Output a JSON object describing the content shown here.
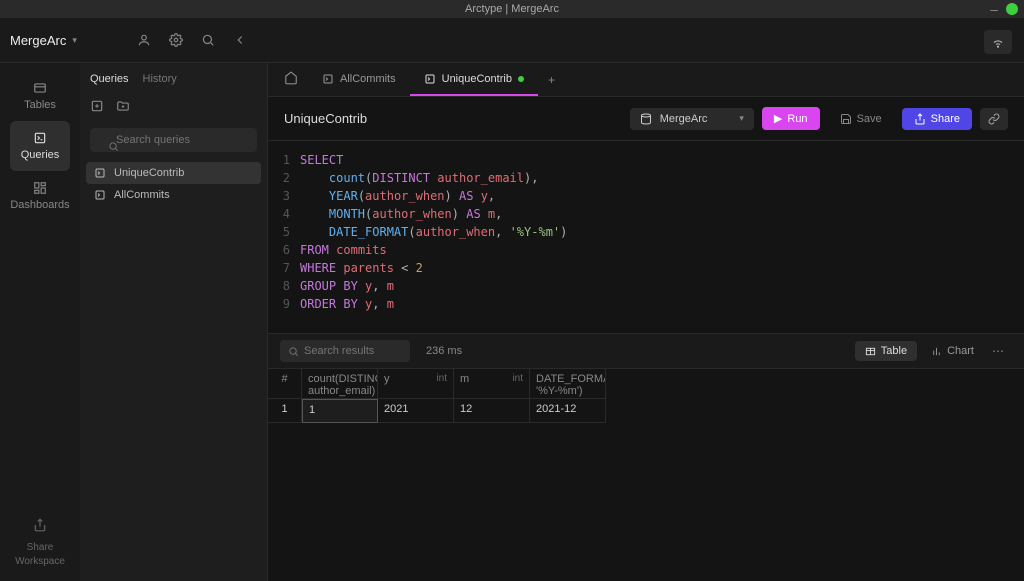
{
  "app": {
    "title": "Arctype | MergeArc"
  },
  "workspace": {
    "name": "MergeArc"
  },
  "iconbar": {
    "tables": "Tables",
    "queries": "Queries",
    "dashboards": "Dashboards",
    "share_ws_line1": "Share",
    "share_ws_line2": "Workspace"
  },
  "queries_sidebar": {
    "tabs": {
      "queries": "Queries",
      "history": "History"
    },
    "search_placeholder": "Search queries",
    "items": [
      {
        "name": "UniqueContrib"
      },
      {
        "name": "AllCommits"
      }
    ]
  },
  "editor_tabs": [
    {
      "name": "AllCommits",
      "active": false,
      "dirty": false
    },
    {
      "name": "UniqueContrib",
      "active": true,
      "dirty": true
    }
  ],
  "query_header": {
    "title": "UniqueContrib",
    "db": "MergeArc",
    "run": "Run",
    "save": "Save",
    "share": "Share"
  },
  "code": {
    "line_count": 9
  },
  "results": {
    "search_placeholder": "Search results",
    "exec_time": "236 ms",
    "view_table": "Table",
    "view_chart": "Chart",
    "columns": [
      {
        "name": "#",
        "type": ""
      },
      {
        "name": "count(DISTINCT author_email)",
        "type": ""
      },
      {
        "name": "y",
        "type": "int"
      },
      {
        "name": "m",
        "type": "int"
      },
      {
        "name": "DATE_FORMAT(auth '%Y-%m')",
        "type": ""
      }
    ],
    "rows": [
      {
        "idx": "1",
        "c1": "1",
        "c2": "2021",
        "c3": "12",
        "c4": "2021-12"
      }
    ]
  }
}
